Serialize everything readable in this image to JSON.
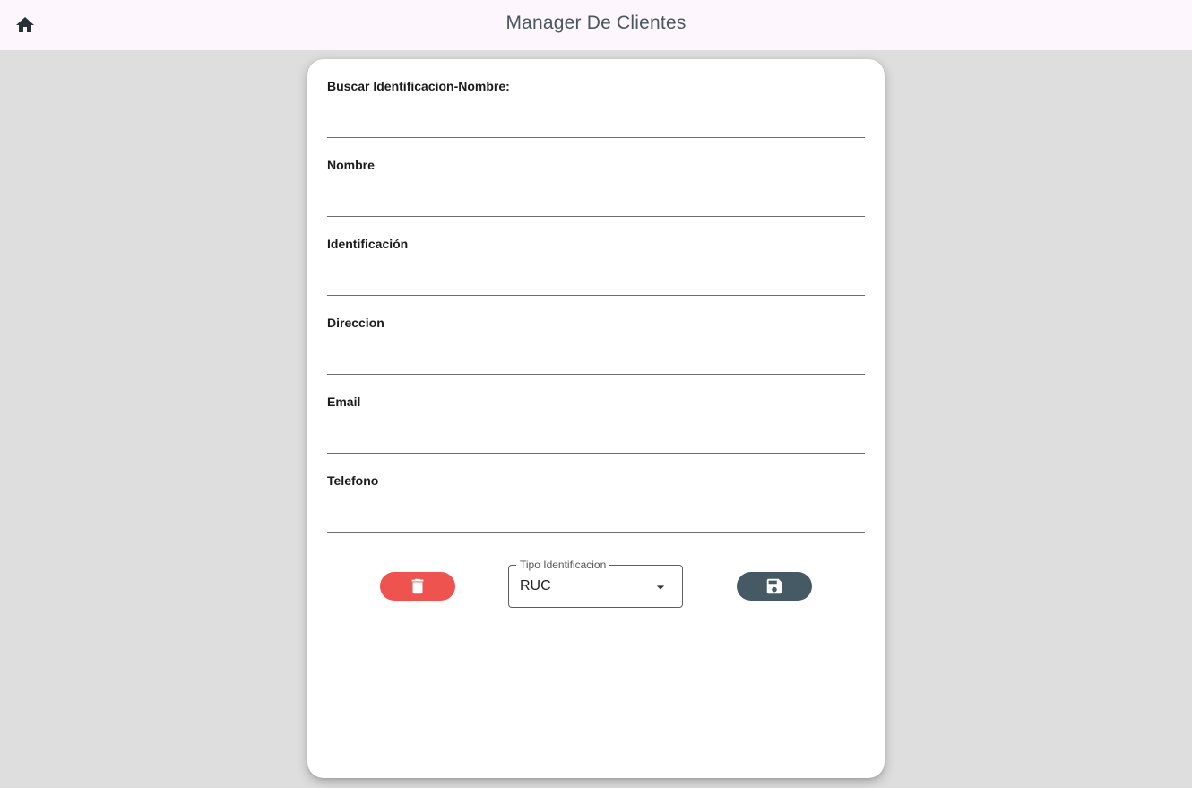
{
  "appbar": {
    "title": "Manager De Clientes",
    "home_icon": "home-icon",
    "icon_color": "#263238"
  },
  "form": {
    "fields": [
      {
        "label": "Buscar Identificacion-Nombre:",
        "value": ""
      },
      {
        "label": "Nombre",
        "value": ""
      },
      {
        "label": "Identificación",
        "value": ""
      },
      {
        "label": "Direccion",
        "value": ""
      },
      {
        "label": "Email",
        "value": ""
      },
      {
        "label": "Telefono",
        "value": ""
      }
    ]
  },
  "actions": {
    "delete_icon": "trash-icon",
    "delete_color": "#ef5350",
    "save_icon": "floppy-disk-icon",
    "save_color": "#455a64"
  },
  "tipo_identificacion": {
    "label": "Tipo Identificacion",
    "selected": "RUC"
  }
}
